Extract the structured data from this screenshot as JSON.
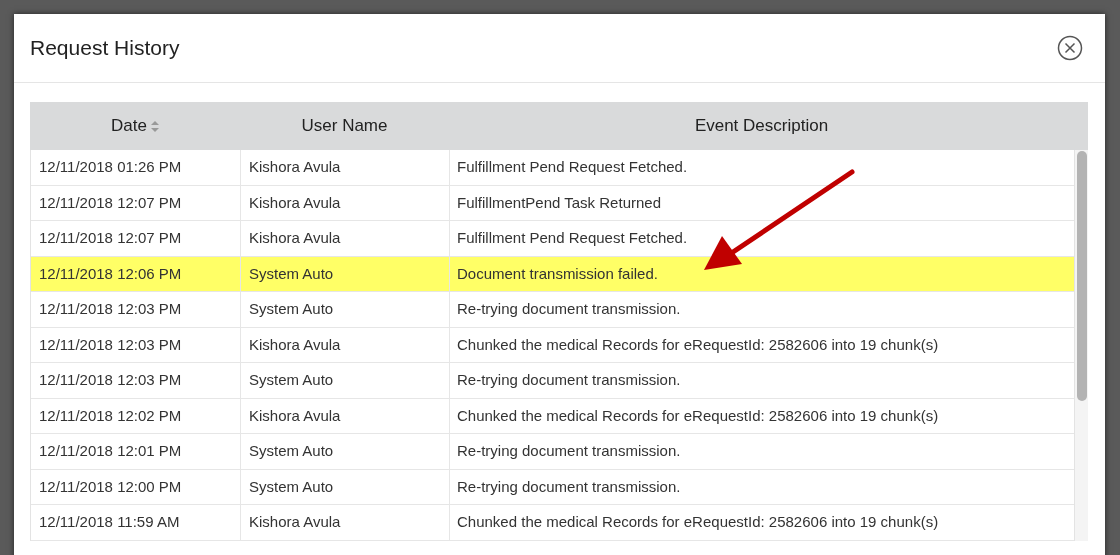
{
  "dialog": {
    "title": "Request History"
  },
  "table": {
    "columns": [
      {
        "label": "Date",
        "sortable": true
      },
      {
        "label": "User Name",
        "sortable": false
      },
      {
        "label": "Event Description",
        "sortable": false
      }
    ],
    "rows": [
      {
        "date": "12/11/2018 01:26 PM",
        "user": "Kishora Avula",
        "event": "Fulfillment Pend Request Fetched.",
        "selected": false
      },
      {
        "date": "12/11/2018 12:07 PM",
        "user": "Kishora Avula",
        "event": "FulfillmentPend Task Returned",
        "selected": false
      },
      {
        "date": "12/11/2018 12:07 PM",
        "user": "Kishora Avula",
        "event": "Fulfillment Pend Request Fetched.",
        "selected": false
      },
      {
        "date": "12/11/2018 12:06 PM",
        "user": "System Auto",
        "event": "Document transmission failed.",
        "selected": true
      },
      {
        "date": "12/11/2018 12:03 PM",
        "user": "System Auto",
        "event": "Re-trying document transmission.",
        "selected": false
      },
      {
        "date": "12/11/2018 12:03 PM",
        "user": "Kishora Avula",
        "event": "Chunked the medical Records for eRequestId: 2582606 into 19 chunk(s)",
        "selected": false
      },
      {
        "date": "12/11/2018 12:03 PM",
        "user": "System Auto",
        "event": "Re-trying document transmission.",
        "selected": false
      },
      {
        "date": "12/11/2018 12:02 PM",
        "user": "Kishora Avula",
        "event": "Chunked the medical Records for eRequestId: 2582606 into 19 chunk(s)",
        "selected": false
      },
      {
        "date": "12/11/2018 12:01 PM",
        "user": "System Auto",
        "event": "Re-trying document transmission.",
        "selected": false
      },
      {
        "date": "12/11/2018 12:00 PM",
        "user": "System Auto",
        "event": "Re-trying document transmission.",
        "selected": false
      },
      {
        "date": "12/11/2018 11:59 AM",
        "user": "Kishora Avula",
        "event": "Chunked the medical Records for eRequestId: 2582606 into 19 chunk(s)",
        "selected": false
      }
    ]
  }
}
